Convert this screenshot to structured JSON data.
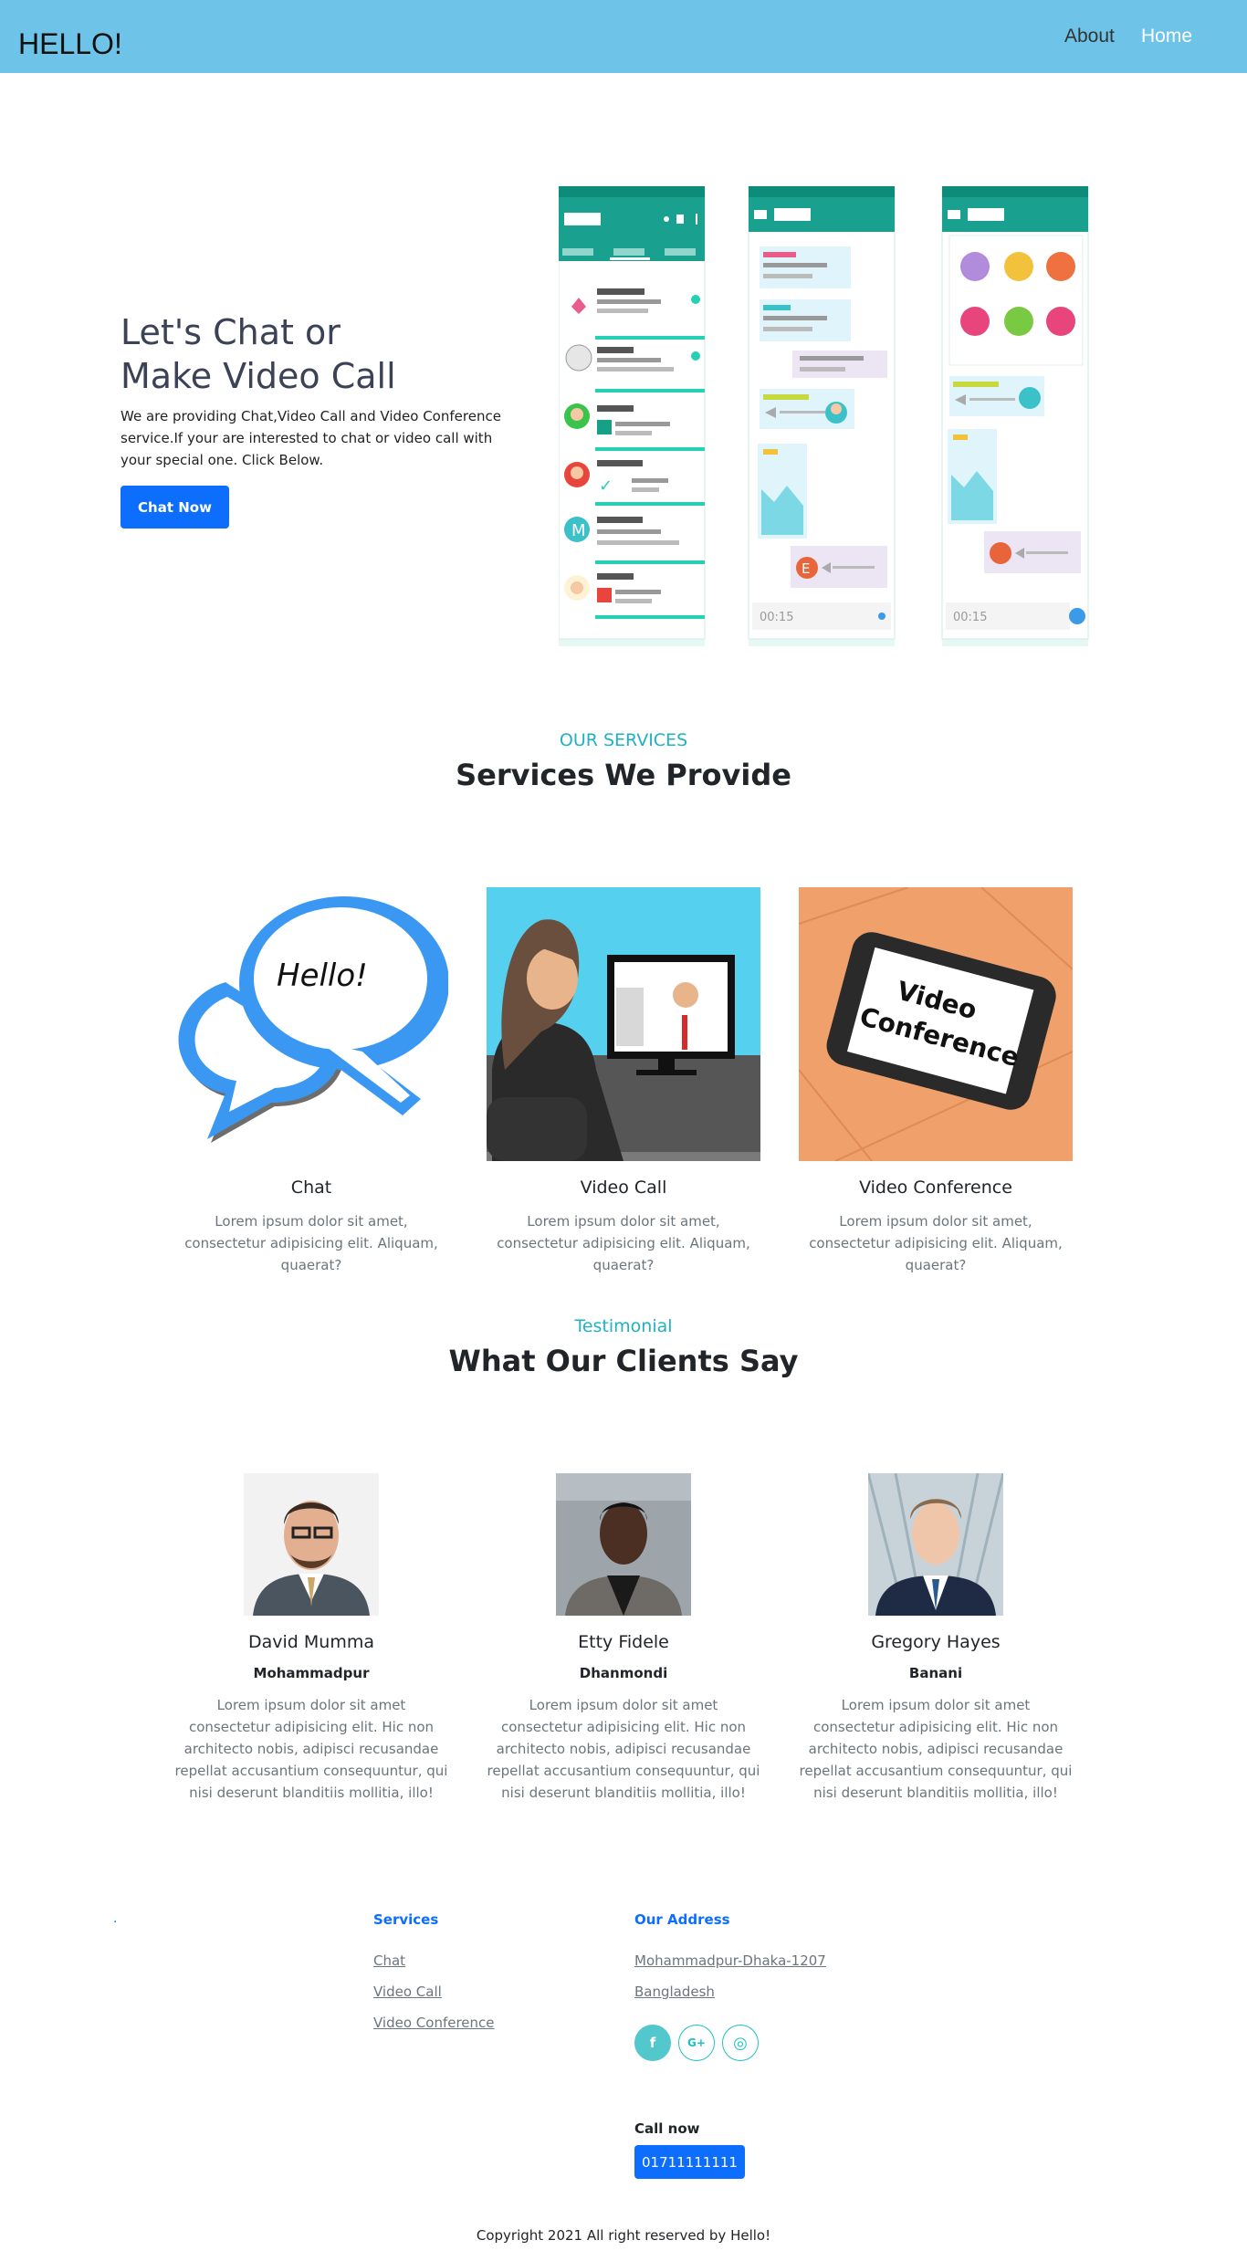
{
  "navbar": {
    "brand": "HELLO!",
    "links": [
      "About",
      "Home"
    ],
    "bg_color": "#6ec4e8"
  },
  "hero": {
    "title_line1": "Let's Chat or",
    "title_line2": "Make Video Call",
    "description": "We are providing Chat,Video Call and Video Conference service.If your are interested to chat or video call with your special one. Click Below.",
    "cta_label": "Chat Now",
    "phone_timer_1": "00:15",
    "phone_timer_2": "00:15",
    "avatar_letter_m": "M",
    "avatar_letter_e": "E"
  },
  "services": {
    "eyebrow": "OUR SERVICES",
    "title": "Services We Provide",
    "items": [
      {
        "name": "Chat",
        "text": "Lorem ipsum dolor sit amet, consectetur adipisicing elit. Aliquam, quaerat?",
        "image_text": "Hello!"
      },
      {
        "name": "Video Call",
        "text": "Lorem ipsum dolor sit amet, consectetur adipisicing elit. Aliquam, quaerat?"
      },
      {
        "name": "Video Conference",
        "text": "Lorem ipsum dolor sit amet, consectetur adipisicing elit. Aliquam, quaerat?",
        "image_text_1": "Video",
        "image_text_2": "Conference"
      }
    ]
  },
  "testimonials": {
    "eyebrow": "Testimonial",
    "title": "What Our Clients Say",
    "items": [
      {
        "name": "David Mumma",
        "location": "Mohammadpur",
        "text": "Lorem ipsum dolor sit amet consectetur adipisicing elit. Hic non architecto nobis, adipisci recusandae repellat accusantium consequuntur, qui nisi deserunt blanditiis mollitia, illo!"
      },
      {
        "name": "Etty Fidele",
        "location": "Dhanmondi",
        "text": "Lorem ipsum dolor sit amet consectetur adipisicing elit. Hic non architecto nobis, adipisci recusandae repellat accusantium consequuntur, qui nisi deserunt blanditiis mollitia, illo!"
      },
      {
        "name": "Gregory Hayes",
        "location": "Banani",
        "text": "Lorem ipsum dolor sit amet consectetur adipisicing elit. Hic non architecto nobis, adipisci recusandae repellat accusantium consequuntur, qui nisi deserunt blanditiis mollitia, illo!"
      }
    ]
  },
  "footer": {
    "dot": ".",
    "services_heading": "Services",
    "service_links": [
      "Chat",
      "Video Call",
      "Video Conference"
    ],
    "address_heading": "Our Address",
    "address_lines": [
      "Mohammadpur-Dhaka-1207",
      "Bangladesh"
    ],
    "social": [
      {
        "icon": "facebook-icon",
        "glyph": "f"
      },
      {
        "icon": "google-plus-icon",
        "glyph": "G+"
      },
      {
        "icon": "instagram-icon",
        "glyph": "◎"
      }
    ],
    "call_label": "Call now",
    "phone": "01711111111",
    "copyright": "Copyright 2021 All right reserved by Hello!"
  },
  "colors": {
    "accent": "#20b2c2",
    "primary": "#0d6efd",
    "whatsapp_green": "#0e8c7a"
  }
}
